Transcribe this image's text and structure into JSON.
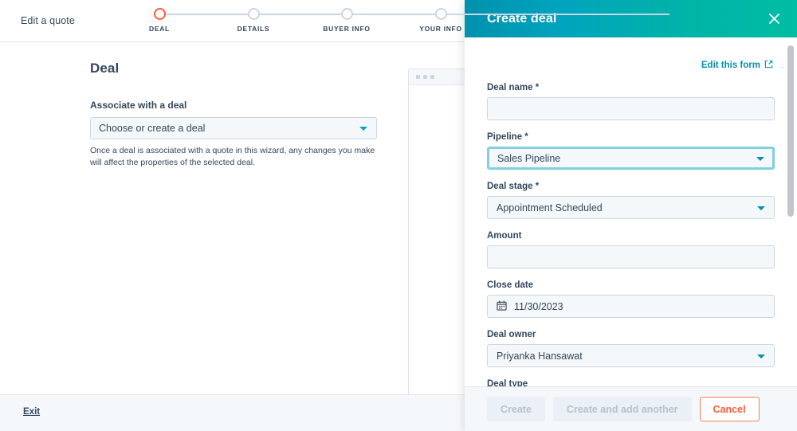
{
  "wizard": {
    "title": "Edit a quote",
    "steps": [
      {
        "label": "DEAL",
        "state": "active"
      },
      {
        "label": "DETAILS",
        "state": "inactive"
      },
      {
        "label": "BUYER INFO",
        "state": "inactive"
      },
      {
        "label": "YOUR INFO",
        "state": "inactive"
      }
    ],
    "heading": "Deal",
    "associate_label": "Associate with a deal",
    "associate_value": "Choose or create a deal",
    "associate_help": "Once a deal is associated with a quote in this wizard, any changes you make will affect the properties of the selected deal.",
    "exit_label": "Exit"
  },
  "panel": {
    "title": "Create deal",
    "close_icon": "close-icon",
    "edit_form_label": "Edit this form",
    "edit_form_icon": "external-link-icon",
    "fields": [
      {
        "label": "Deal name *",
        "value": "",
        "type": "text",
        "focused": false
      },
      {
        "label": "Pipeline *",
        "value": "Sales Pipeline",
        "type": "select",
        "focused": true
      },
      {
        "label": "Deal stage *",
        "value": "Appointment Scheduled",
        "type": "select",
        "focused": false
      },
      {
        "label": "Amount",
        "value": "",
        "type": "text",
        "focused": false
      },
      {
        "label": "Close date",
        "value": "11/30/2023",
        "type": "date",
        "focused": false
      },
      {
        "label": "Deal owner",
        "value": "Priyanka Hansawat",
        "type": "select",
        "focused": false
      }
    ],
    "clipped_field_label": "Deal type",
    "buttons": {
      "create": "Create",
      "create_and_add": "Create and add another",
      "cancel": "Cancel"
    }
  },
  "colors": {
    "header_gradient_start": "#0091ae",
    "header_gradient_end": "#00bda5",
    "accent_teal": "#00a4bd",
    "accent_orange": "#ff5c35",
    "link_blue": "#0091ae",
    "text": "#33475b",
    "border": "#cbd6e2",
    "field_bg": "#f5f8fa"
  }
}
